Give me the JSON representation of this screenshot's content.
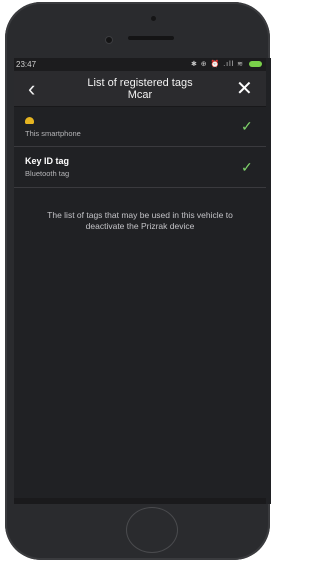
{
  "status_bar": {
    "time": "23:47",
    "icons_text": "✱ ⊕ ⏰ .ıll ≋",
    "battery_color": "#7ad14a"
  },
  "header": {
    "back_icon": "chevron-left-icon",
    "title_line1": "List of registered tags",
    "title_line2": "Mcar",
    "close_icon": "close-icon"
  },
  "tags": [
    {
      "name": "",
      "subtitle": "This smartphone",
      "status": "registered",
      "icon": "smartphone-icon"
    },
    {
      "name": "Key ID tag",
      "subtitle": "Bluetooth tag",
      "status": "registered"
    }
  ],
  "info_text": "The list of tags that may be used in this vehicle to deactivate the Prizrak device",
  "colors": {
    "accent_check": "#7fd36a",
    "tag_icon": "#e5b421",
    "background": "#202124"
  }
}
